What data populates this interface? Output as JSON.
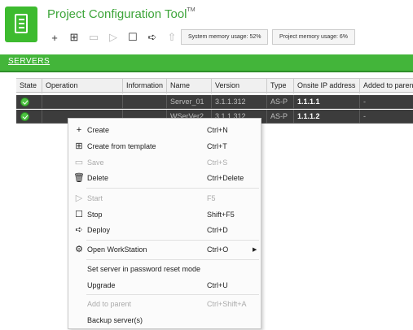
{
  "app": {
    "title": "Project Configuration Tool",
    "trademark": "TM",
    "brand_color": "#43b53a",
    "logo_icon": "document-list-icon"
  },
  "toolbar": {
    "icons": [
      {
        "name": "create-icon",
        "glyph": "+"
      },
      {
        "name": "create-from-template-icon",
        "glyph": "⊞"
      },
      {
        "name": "save-icon",
        "glyph": "▭"
      },
      {
        "name": "start-icon",
        "glyph": "▷"
      },
      {
        "name": "stop-icon",
        "glyph": "☐"
      },
      {
        "name": "deploy-icon",
        "glyph": "➪"
      },
      {
        "name": "upgrade-icon",
        "glyph": "⇧"
      }
    ],
    "system_memory": "System memory usage: 52%",
    "project_memory": "Project memory usage: 6%"
  },
  "tabs": {
    "servers": "SERVERS"
  },
  "grid": {
    "columns": [
      "State",
      "Operation",
      "Information",
      "Name",
      "Version",
      "Type",
      "Onsite IP address",
      "Added to paren"
    ],
    "rows": [
      {
        "state": "ok",
        "operation": "",
        "information": "",
        "name": "Server_01",
        "version": "3.1.1.312",
        "type": "AS-P",
        "ip": "1.1.1.1",
        "parent": "-"
      },
      {
        "state": "ok",
        "operation": "",
        "information": "",
        "name": "WSerVer2",
        "version": "3.1.1.312",
        "type": "AS-P",
        "ip": "1.1.1.2",
        "parent": "-"
      }
    ]
  },
  "context_menu": {
    "items": [
      {
        "icon": "+",
        "icon_name": "plus-icon",
        "label": "Create",
        "shortcut": "Ctrl+N",
        "disabled": false
      },
      {
        "icon": "⊞",
        "icon_name": "template-icon",
        "label": "Create from template",
        "shortcut": "Ctrl+T",
        "disabled": false
      },
      {
        "icon": "▭",
        "icon_name": "save-icon",
        "label": "Save",
        "shortcut": "Ctrl+S",
        "disabled": true
      },
      {
        "icon": "🗑",
        "icon_name": "trash-icon",
        "label": "Delete",
        "shortcut": "Ctrl+Delete",
        "disabled": false
      },
      {
        "icon": "▷",
        "icon_name": "play-icon",
        "label": "Start",
        "shortcut": "F5",
        "disabled": true
      },
      {
        "icon": "☐",
        "icon_name": "stop-icon",
        "label": "Stop",
        "shortcut": "Shift+F5",
        "disabled": false
      },
      {
        "icon": "➪",
        "icon_name": "deploy-icon",
        "label": "Deploy",
        "shortcut": "Ctrl+D",
        "disabled": false
      },
      {
        "icon": "⚙",
        "icon_name": "workstation-icon",
        "label": "Open WorkStation",
        "shortcut": "Ctrl+O",
        "disabled": false,
        "submenu": true
      },
      {
        "icon": "",
        "icon_name": "",
        "label": "Set server in password reset mode",
        "shortcut": "",
        "disabled": false
      },
      {
        "icon": "",
        "icon_name": "",
        "label": "Upgrade",
        "shortcut": "Ctrl+U",
        "disabled": false
      },
      {
        "icon": "",
        "icon_name": "",
        "label": "Add to parent",
        "shortcut": "Ctrl+Shift+A",
        "disabled": true
      },
      {
        "icon": "",
        "icon_name": "",
        "label": "Backup server(s)",
        "shortcut": "",
        "disabled": false
      }
    ]
  }
}
